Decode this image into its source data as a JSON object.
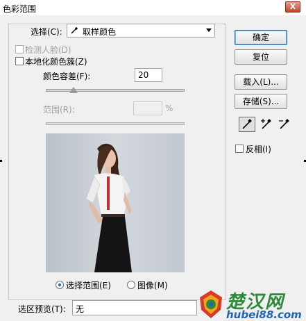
{
  "window": {
    "title": "色彩范围",
    "close_label": "X"
  },
  "select": {
    "label": "选择(C):",
    "value": "取样颜色"
  },
  "options": {
    "detect_faces": "检测人脸(D)",
    "localized": "本地化颜色簇(Z)"
  },
  "fuzziness": {
    "label": "颜色容差(F):",
    "value": "20",
    "fraction": 0.2
  },
  "range": {
    "label": "范围(R):",
    "value": "",
    "unit": "%"
  },
  "view": {
    "selection": "选择范围(E)",
    "image": "图像(M)"
  },
  "preview": {
    "label": "选区预览(T):",
    "value": "无"
  },
  "buttons": {
    "ok": "确定",
    "reset": "复位",
    "load": "载入(L)...",
    "save": "存储(S)..."
  },
  "invert_label": "反相(I)",
  "watermark": {
    "title": "楚汉网",
    "url": "hubei88.com"
  },
  "colors": {
    "accent": "#1a5fb4",
    "watermark_green": "#2d8a3a",
    "watermark_blue": "#1f64b0"
  }
}
